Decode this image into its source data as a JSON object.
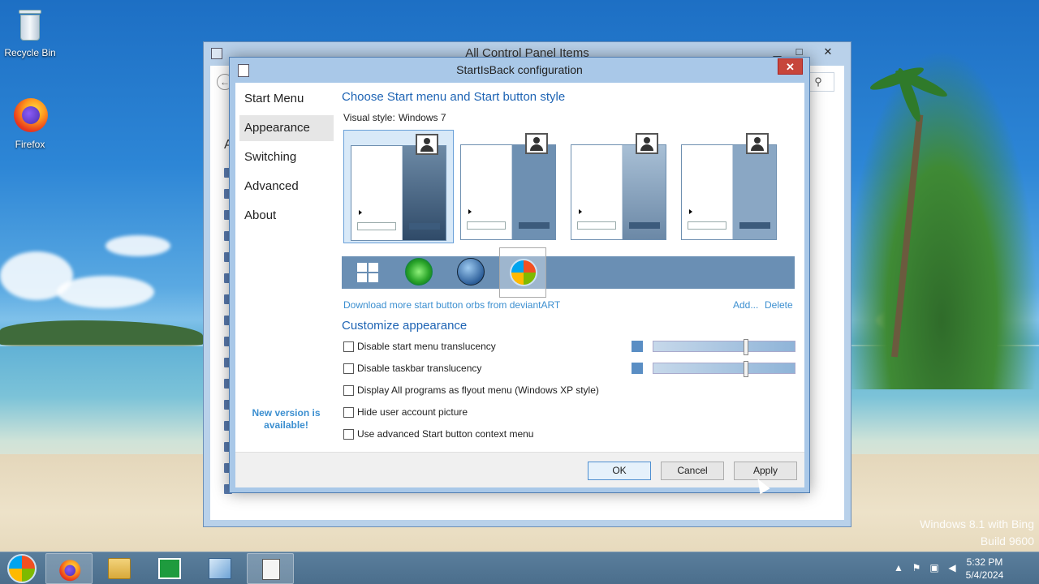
{
  "desktop": {
    "icons": [
      {
        "label": "Recycle Bin",
        "icon": "recycle-bin-icon"
      },
      {
        "label": "Firefox",
        "icon": "firefox-icon"
      }
    ],
    "watermark_line1": "Windows 8.1 with Bing",
    "watermark_line2": "Build 9600"
  },
  "control_panel": {
    "title": "All Control Panel Items",
    "minimize": "▁",
    "maximize": "□",
    "close": "✕",
    "search_glyph": "⚲",
    "back_glyph": "←",
    "heading_letter": "A"
  },
  "dialog": {
    "title": "StartIsBack configuration",
    "close": "✕",
    "sidebar": {
      "items": [
        "Start Menu",
        "Appearance",
        "Switching",
        "Advanced",
        "About"
      ],
      "active_index": 1,
      "new_version": "New version is available!"
    },
    "content": {
      "heading1": "Choose Start menu and Start button style",
      "visual_style_label": "Visual style:",
      "visual_style_value": "Windows 7",
      "styles_selected_index": 0,
      "orbs": [
        "windows8-orb-icon",
        "clover-orb-icon",
        "windows-flag-orb-icon",
        "windows7-orb-icon"
      ],
      "orbs_selected_index": 3,
      "download_link": "Download more start button orbs from deviantART",
      "add_link": "Add...",
      "delete_link": "Delete",
      "heading2": "Customize appearance",
      "checkboxes": [
        {
          "label": "Disable start menu translucency",
          "checked": false
        },
        {
          "label": "Disable taskbar translucency",
          "checked": false
        },
        {
          "label": "Display All programs as flyout menu (Windows XP style)",
          "checked": false
        },
        {
          "label": "Hide user account picture",
          "checked": false
        },
        {
          "label": "Use advanced Start button context menu",
          "checked": false
        }
      ],
      "translucency_sliders": [
        0.64,
        0.64
      ]
    },
    "buttons": {
      "ok": "OK",
      "cancel": "Cancel",
      "apply": "Apply"
    }
  },
  "taskbar": {
    "apps": [
      "firefox-icon",
      "file-explorer-icon",
      "store-icon",
      "control-panel-icon",
      "startisback-icon"
    ],
    "active_index": 0,
    "clock_time": "5:32 PM",
    "clock_date": "5/4/2024",
    "tray_overflow": "▲"
  },
  "colors": {
    "accent": "#1e64b4",
    "link": "#3c8fd0",
    "close_red": "#c7463b"
  }
}
